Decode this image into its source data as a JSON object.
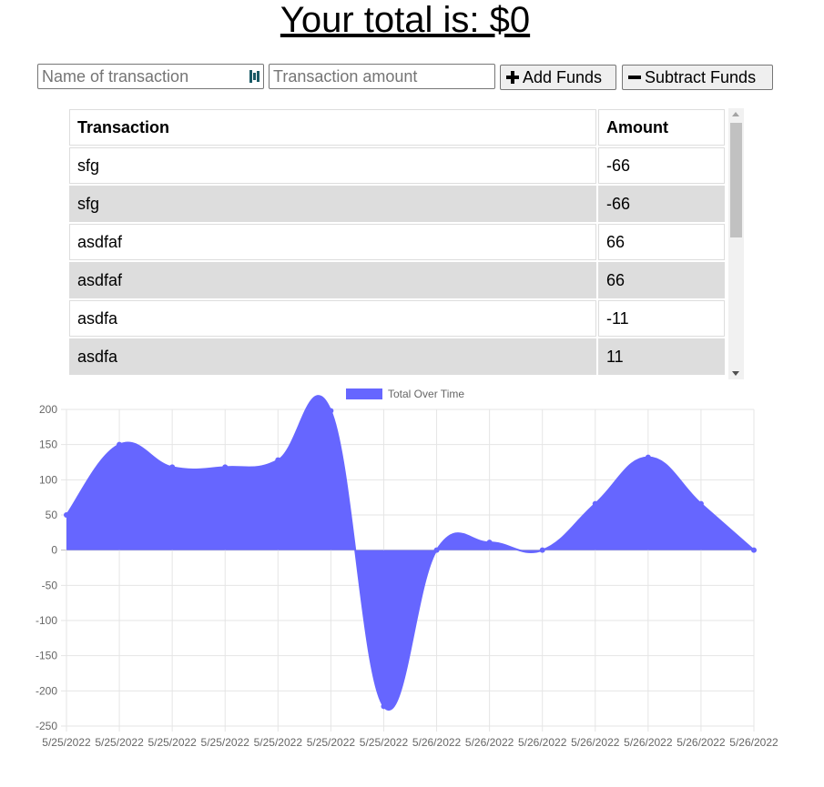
{
  "header": {
    "total_text": "Your total is: $0"
  },
  "form": {
    "name_placeholder": "Name of transaction",
    "amount_placeholder": "Transaction amount",
    "add_label": "Add Funds",
    "subtract_label": "Subtract Funds"
  },
  "table": {
    "headers": [
      "Transaction",
      "Amount"
    ],
    "rows": [
      {
        "name": "sfg",
        "amount": "-66"
      },
      {
        "name": "sfg",
        "amount": "-66"
      },
      {
        "name": "asdfaf",
        "amount": "66"
      },
      {
        "name": "asdfaf",
        "amount": "66"
      },
      {
        "name": "asdfa",
        "amount": "-11"
      },
      {
        "name": "asdfa",
        "amount": "11"
      }
    ]
  },
  "colors": {
    "series_fill": "#6666ff",
    "series_line": "#6666ff",
    "grid": "#e5e5e5",
    "alt_row": "#dddddd"
  },
  "chart_data": {
    "type": "area",
    "legend": "Total Over Time",
    "legend_position": "top-center",
    "grid": true,
    "ylim": [
      -250,
      200
    ],
    "yticks": [
      200,
      150,
      100,
      50,
      0,
      -50,
      -100,
      -150,
      -200,
      -250
    ],
    "x": [
      "5/25/2022",
      "5/25/2022",
      "5/25/2022",
      "5/25/2022",
      "5/25/2022",
      "5/25/2022",
      "5/25/2022",
      "5/26/2022",
      "5/26/2022",
      "5/26/2022",
      "5/26/2022",
      "5/26/2022",
      "5/26/2022",
      "5/26/2022"
    ],
    "series": [
      {
        "name": "Total Over Time",
        "values": [
          50,
          150,
          118,
          118,
          128,
          198,
          -222,
          0,
          11,
          0,
          66,
          132,
          66,
          0
        ]
      }
    ]
  }
}
